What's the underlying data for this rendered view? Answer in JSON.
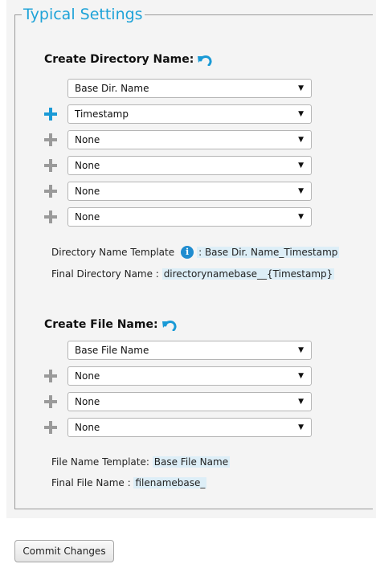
{
  "legend": "Typical Settings",
  "directory": {
    "title": "Create Directory Name:",
    "selects": [
      "Base Dir. Name",
      "Timestamp",
      "None",
      "None",
      "None",
      "None"
    ],
    "template_label": "Directory Name Template",
    "template_value": ": Base Dir. Name_Timestamp",
    "final_label": "Final Directory Name :",
    "final_value": "directorynamebase__{Timestamp}"
  },
  "file": {
    "title": "Create File Name:",
    "selects": [
      "Base File Name",
      "None",
      "None",
      "None"
    ],
    "template_label": "File Name Template:",
    "template_value": "Base File Name",
    "final_label": "Final File Name :",
    "final_value": "filenamebase_"
  },
  "commit_label": "Commit Changes",
  "colors": {
    "accent": "#1fa3d8",
    "plus_active": "#1a9ad6",
    "plus_inactive": "#9a9a9a",
    "highlight": "#ddeef7"
  },
  "icons": {
    "undo": "undo-icon",
    "plus": "plus-icon",
    "info": "info-icon",
    "dropdown": "chevron-down-icon"
  }
}
